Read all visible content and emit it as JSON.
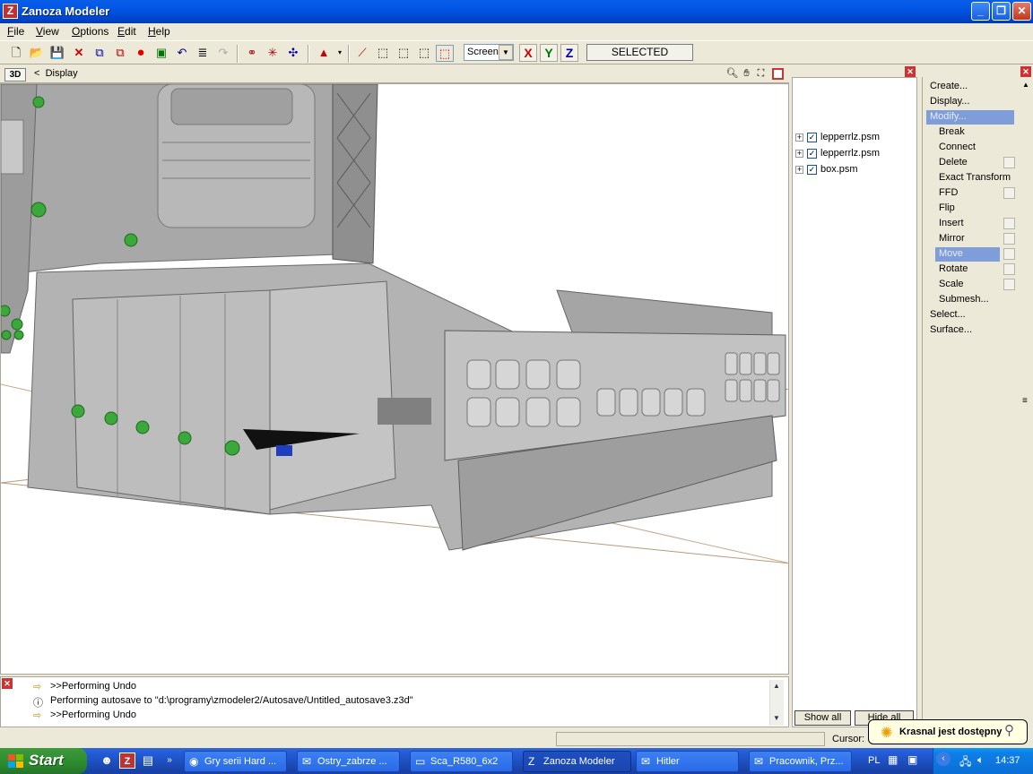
{
  "app": {
    "title": "Zanoza Modeler",
    "icon_letter": "Z"
  },
  "window_buttons": {
    "minimize": "_",
    "maximize": "❐",
    "close": "✕"
  },
  "menu": [
    "File",
    "View",
    "Options",
    "Edit",
    "Help"
  ],
  "toolbar": {
    "screen_select": "Screen",
    "axis_x": "X",
    "axis_y": "Y",
    "axis_z": "Z",
    "selected_label": "SELECTED"
  },
  "viewport": {
    "mode": "3D",
    "breadcrumb_arrow": "<",
    "breadcrumb_label": "Display"
  },
  "layers": {
    "items": [
      {
        "name": "lepperrlz.psm",
        "checked": true
      },
      {
        "name": "lepperrlz.psm",
        "checked": true
      },
      {
        "name": "box.psm",
        "checked": true
      }
    ],
    "show_all": "Show all",
    "hide_all": "Hide all"
  },
  "commands": {
    "create": "Create...",
    "display": "Display...",
    "modify": "Modify...",
    "modify_items": [
      "Break",
      "Connect",
      "Delete",
      "Exact Transform",
      "FFD",
      "Flip",
      "Insert",
      "Mirror",
      "Move",
      "Rotate",
      "Scale",
      "Submesh..."
    ],
    "select": "Select...",
    "surface": "Surface...",
    "active_item": "Move"
  },
  "log": {
    "lines": [
      {
        "icon": "arrow-icon",
        "text": ">>Performing Undo"
      },
      {
        "icon": "info-icon",
        "text": "Performing autosave to \"d:\\programy\\zmodeler2/Autosave/Untitled_autosave3.z3d\""
      },
      {
        "icon": "arrow-icon",
        "text": ">>Performing Undo"
      }
    ]
  },
  "status": {
    "cursor_label": "Cursor:"
  },
  "balloon": {
    "text": "Krasnal jest dostępny"
  },
  "taskbar": {
    "start": "Start",
    "tasks": [
      {
        "label": "Gry serii Hard ...",
        "icon": "firefox-icon"
      },
      {
        "label": "Ostry_zabrze ...",
        "icon": "mail-icon"
      },
      {
        "label": "Sca_R580_6x2",
        "icon": "folder-icon"
      },
      {
        "label": "Zanoza Modeler",
        "icon": "zanoza-icon",
        "active": true
      },
      {
        "label": "Hitler",
        "icon": "mail-icon"
      },
      {
        "label": "Pracownik, Prz...",
        "icon": "mail-icon"
      }
    ],
    "language": "PL",
    "clock": "14:37"
  },
  "colors": {
    "titlebar": "#0055e5",
    "taskbar": "#245edb",
    "start": "#2d8a2d",
    "highlight": "#7f9ed9",
    "model": "#9a9a9a"
  }
}
